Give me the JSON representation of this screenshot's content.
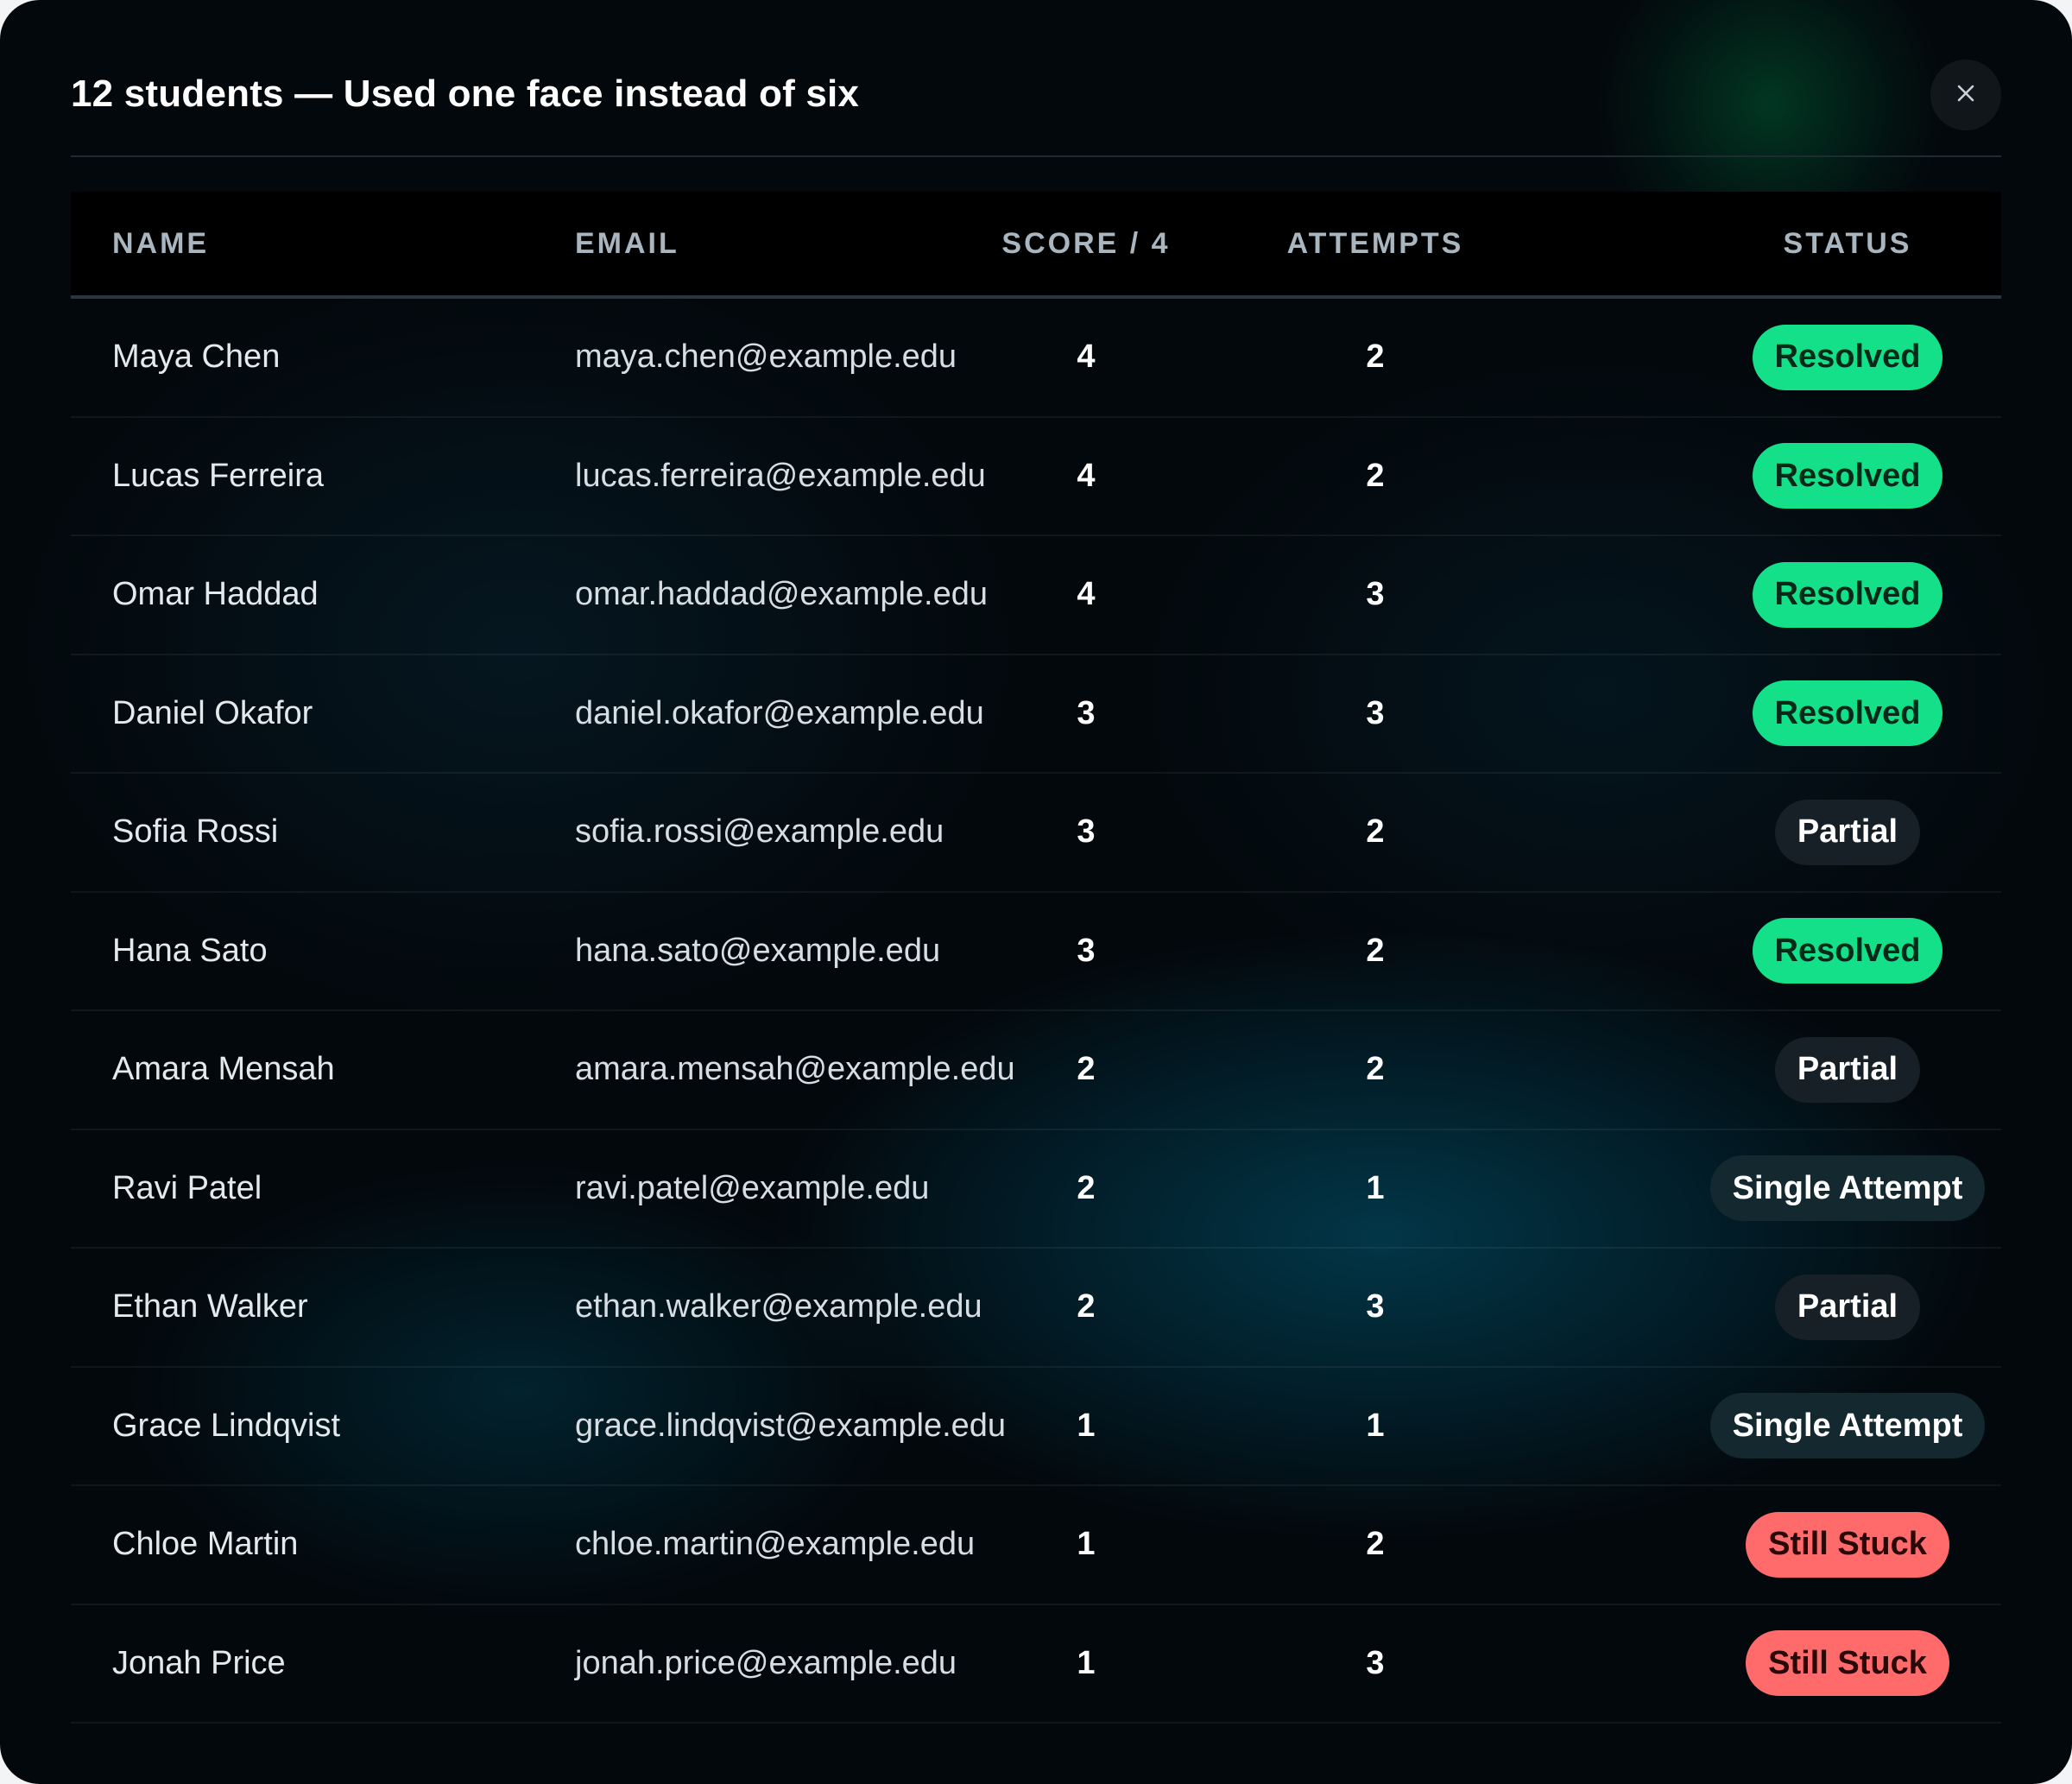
{
  "modal": {
    "title": "12 students — Used one face instead of six",
    "close_icon": "close-icon"
  },
  "table": {
    "headers": {
      "name": "NAME",
      "email": "EMAIL",
      "score": "SCORE / 4",
      "attempts": "ATTEMPTS",
      "status": "STATUS"
    },
    "rows": [
      {
        "name": "Maya Chen",
        "email": "maya.chen@example.edu",
        "score": "4",
        "attempts": "2",
        "status": "Resolved",
        "status_kind": "resolved"
      },
      {
        "name": "Lucas Ferreira",
        "email": "lucas.ferreira@example.edu",
        "score": "4",
        "attempts": "2",
        "status": "Resolved",
        "status_kind": "resolved"
      },
      {
        "name": "Omar Haddad",
        "email": "omar.haddad@example.edu",
        "score": "4",
        "attempts": "3",
        "status": "Resolved",
        "status_kind": "resolved"
      },
      {
        "name": "Daniel Okafor",
        "email": "daniel.okafor@example.edu",
        "score": "3",
        "attempts": "3",
        "status": "Resolved",
        "status_kind": "resolved"
      },
      {
        "name": "Sofia Rossi",
        "email": "sofia.rossi@example.edu",
        "score": "3",
        "attempts": "2",
        "status": "Partial",
        "status_kind": "partial"
      },
      {
        "name": "Hana Sato",
        "email": "hana.sato@example.edu",
        "score": "3",
        "attempts": "2",
        "status": "Resolved",
        "status_kind": "resolved"
      },
      {
        "name": "Amara Mensah",
        "email": "amara.mensah@example.edu",
        "score": "2",
        "attempts": "2",
        "status": "Partial",
        "status_kind": "partial"
      },
      {
        "name": "Ravi Patel",
        "email": "ravi.patel@example.edu",
        "score": "2",
        "attempts": "1",
        "status": "Single Attempt",
        "status_kind": "single"
      },
      {
        "name": "Ethan Walker",
        "email": "ethan.walker@example.edu",
        "score": "2",
        "attempts": "3",
        "status": "Partial",
        "status_kind": "partial"
      },
      {
        "name": "Grace Lindqvist",
        "email": "grace.lindqvist@example.edu",
        "score": "1",
        "attempts": "1",
        "status": "Single Attempt",
        "status_kind": "single"
      },
      {
        "name": "Chloe Martin",
        "email": "chloe.martin@example.edu",
        "score": "1",
        "attempts": "2",
        "status": "Still Stuck",
        "status_kind": "stuck"
      },
      {
        "name": "Jonah Price",
        "email": "jonah.price@example.edu",
        "score": "1",
        "attempts": "3",
        "status": "Still Stuck",
        "status_kind": "stuck"
      }
    ]
  },
  "colors": {
    "background": "#03080c",
    "resolved": "#14e08a",
    "partial": "#172026",
    "single_attempt": "#142830",
    "still_stuck": "#ff6b6b"
  }
}
